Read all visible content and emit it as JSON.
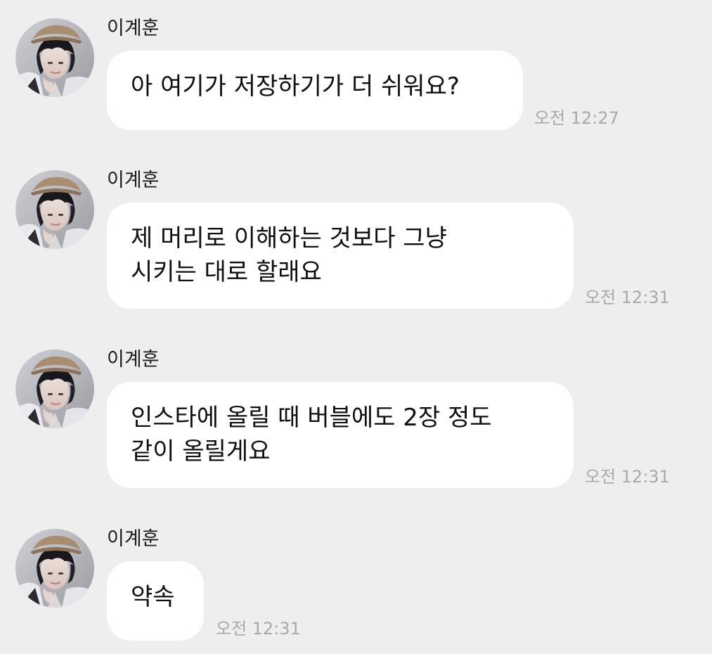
{
  "chat": {
    "messages": [
      {
        "sender": "이계훈",
        "lines": [
          "아 여기가 저장하기가 더 쉬워요?"
        ],
        "time": "오전 12:27"
      },
      {
        "sender": "이계훈",
        "lines": [
          "제 머리로 이해하는 것보다 그냥",
          "시키는 대로 할래요"
        ],
        "time": "오전 12:31"
      },
      {
        "sender": "이계훈",
        "lines": [
          "인스타에 올릴 때 버블에도 2장 정도",
          "같이 올릴게요"
        ],
        "time": "오전 12:31"
      },
      {
        "sender": "이계훈",
        "lines": [
          "약속"
        ],
        "time": "오전 12:31"
      }
    ]
  }
}
